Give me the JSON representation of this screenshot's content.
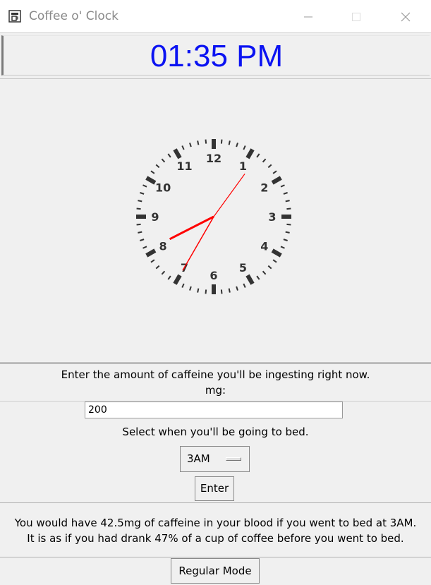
{
  "window": {
    "title": "Coffee o' Clock",
    "minimize_icon": "minimize-icon",
    "maximize_icon": "maximize-icon",
    "close_icon": "close-icon",
    "app_icon": "coffee-machine-icon"
  },
  "clock": {
    "digital_time": "01:35 PM",
    "digital_color": "#0b13f2",
    "hand_color": "#ff0000",
    "hour": 1,
    "minute": 35,
    "second": 6,
    "numbers": [
      "12",
      "1",
      "2",
      "3",
      "4",
      "5",
      "6",
      "7",
      "8",
      "9",
      "10",
      "11"
    ]
  },
  "form": {
    "prompt_caffeine": "Enter the amount of caffeine you'll be ingesting right now.",
    "mg_label": "mg:",
    "mg_value": "200",
    "prompt_bed": "Select when you'll be going to bed.",
    "bed_selected": "3AM",
    "enter_label": "Enter"
  },
  "result": {
    "line1": "You would have 42.5mg of caffeine in your blood if you went to bed at 3AM.",
    "line2": "It is as if you had drank 47% of a cup of coffee before you went to bed."
  },
  "mode_button": {
    "label": "Regular Mode"
  }
}
